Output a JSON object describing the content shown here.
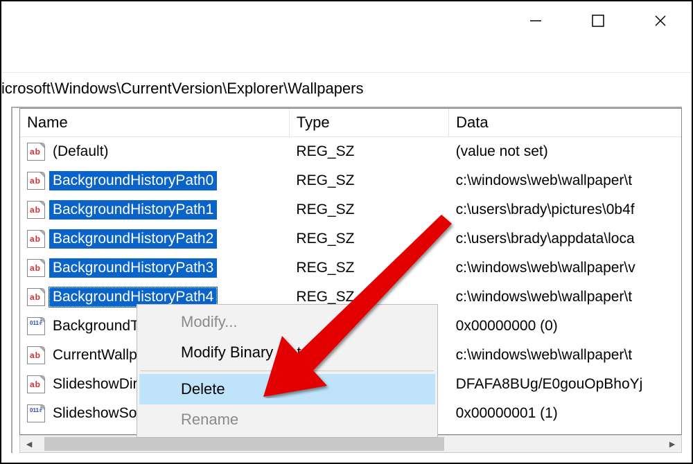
{
  "titlebar": {
    "minimize_glyph": "—",
    "maximize_glyph": "☐",
    "close_glyph": "✕"
  },
  "address": "icrosoft\\Windows\\CurrentVersion\\Explorer\\Wallpapers",
  "columns": {
    "name": "Name",
    "type": "Type",
    "data": "Data"
  },
  "rows": [
    {
      "icon": "str",
      "sel": false,
      "focus": false,
      "name": "(Default)",
      "type": "REG_SZ",
      "data": "(value not set)"
    },
    {
      "icon": "str",
      "sel": true,
      "focus": false,
      "name": "BackgroundHistoryPath0",
      "type": "REG_SZ",
      "data": "c:\\windows\\web\\wallpaper\\t"
    },
    {
      "icon": "str",
      "sel": true,
      "focus": false,
      "name": "BackgroundHistoryPath1",
      "type": "REG_SZ",
      "data": "c:\\users\\brady\\pictures\\0b4f"
    },
    {
      "icon": "str",
      "sel": true,
      "focus": false,
      "name": "BackgroundHistoryPath2",
      "type": "REG_SZ",
      "data": "c:\\users\\brady\\appdata\\loca"
    },
    {
      "icon": "str",
      "sel": true,
      "focus": false,
      "name": "BackgroundHistoryPath3",
      "type": "REG_SZ",
      "data": "c:\\windows\\web\\wallpaper\\v"
    },
    {
      "icon": "str",
      "sel": true,
      "focus": true,
      "name": "BackgroundHistoryPath4",
      "type": "REG_SZ",
      "data": "c:\\windows\\web\\wallpaper\\t"
    },
    {
      "icon": "bin",
      "sel": false,
      "focus": false,
      "name": "BackgroundT",
      "type": "",
      "data": "0x00000000 (0)"
    },
    {
      "icon": "str",
      "sel": false,
      "focus": false,
      "name": "CurrentWallp",
      "type": "",
      "data": "c:\\windows\\web\\wallpaper\\t"
    },
    {
      "icon": "str",
      "sel": false,
      "focus": false,
      "name": "SlideshowDir",
      "type": "",
      "data": "DFAFA8BUg/E0gouOpBhoYj"
    },
    {
      "icon": "bin",
      "sel": false,
      "focus": false,
      "name": "SlideshowSo",
      "type": "",
      "data": "0x00000001 (1)"
    }
  ],
  "context_menu": {
    "modify": "Modify...",
    "modify_binary": "Modify Binary Data...",
    "delete": "Delete",
    "rename": "Rename"
  }
}
